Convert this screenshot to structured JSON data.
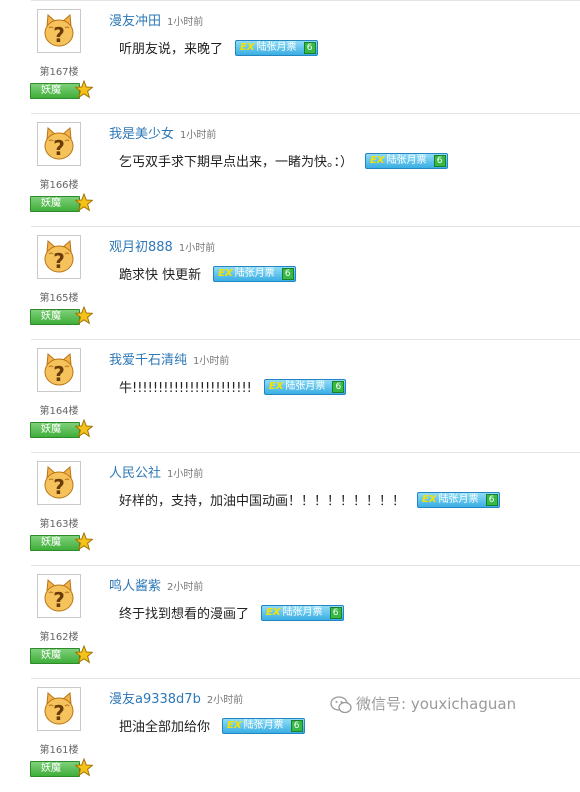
{
  "comments": [
    {
      "username": "漫友冲田",
      "time": "1小时前",
      "text": "听朋友说，来晚了",
      "floor": "第167楼",
      "rank": "妖魔",
      "ticket_label": "陆张月票",
      "ticket_count": "6"
    },
    {
      "username": "我是美少女",
      "time": "1小时前",
      "text": "乞丐双手求下期早点出来，一睹为快。：）",
      "floor": "第166楼",
      "rank": "妖魔",
      "ticket_label": "陆张月票",
      "ticket_count": "6"
    },
    {
      "username": "观月初888",
      "time": "1小时前",
      "text": "跪求快 快更新",
      "floor": "第165楼",
      "rank": "妖魔",
      "ticket_label": "陆张月票",
      "ticket_count": "6"
    },
    {
      "username": "我爱千石清纯",
      "time": "1小时前",
      "text": "牛!!!!!!!!!!!!!!!!!!!!!!!",
      "floor": "第164楼",
      "rank": "妖魔",
      "ticket_label": "陆张月票",
      "ticket_count": "6"
    },
    {
      "username": "人民公社",
      "time": "1小时前",
      "text": "好样的，支持，加油中国动画！！！！！！！！！",
      "floor": "第163楼",
      "rank": "妖魔",
      "ticket_label": "陆张月票",
      "ticket_count": "6"
    },
    {
      "username": "鸣人酱紫",
      "time": "2小时前",
      "text": "终于找到想看的漫画了",
      "floor": "第162楼",
      "rank": "妖魔",
      "ticket_label": "陆张月票",
      "ticket_count": "6"
    },
    {
      "username": "漫友a9338d7b",
      "time": "2小时前",
      "text": "把油全部加给你",
      "floor": "第161楼",
      "rank": "妖魔",
      "ticket_label": "陆张月票",
      "ticket_count": "6"
    }
  ],
  "ticket_prefix": "EX",
  "watermark": "微信号: youxichaguan",
  "icons": {
    "avatar": "cat-question-mark-avatar-icon",
    "rank": "star-icon",
    "watermark": "wechat-icon"
  },
  "colors": {
    "username": "#2e78b7",
    "rank_badge": "#3fae3a",
    "ticket": "#3aaee4",
    "ticket_count": "#37b947",
    "divider": "#e3e3e3"
  }
}
